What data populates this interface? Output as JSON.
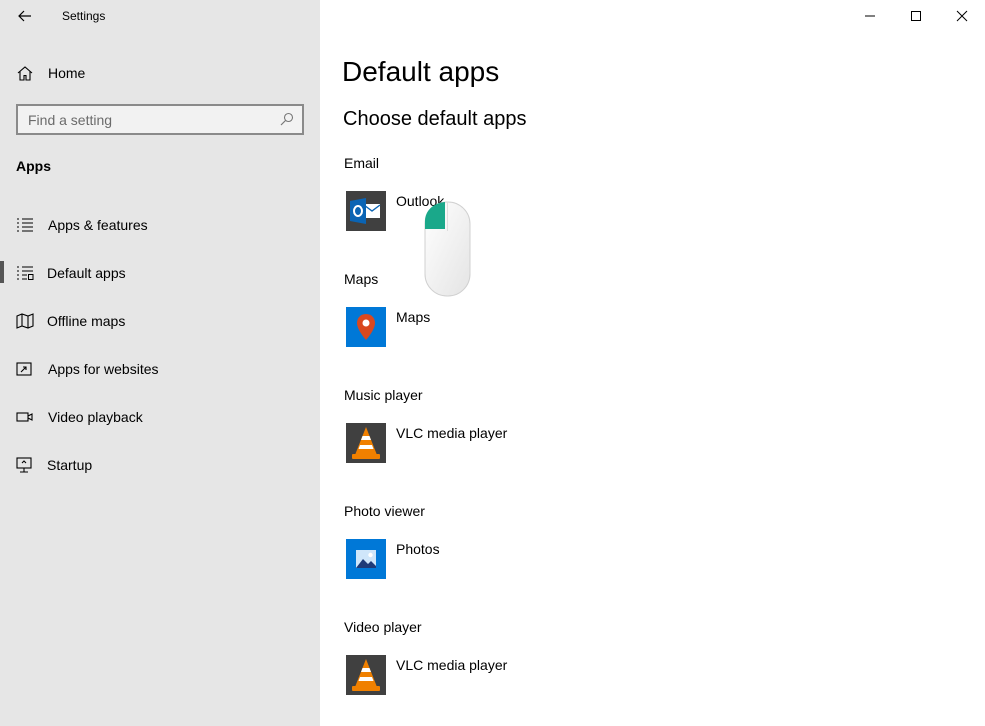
{
  "window": {
    "title": "Settings",
    "controls": {
      "minimize_icon": "minimize-icon",
      "maximize_icon": "maximize-icon",
      "close_icon": "close-icon"
    }
  },
  "sidebar": {
    "home_label": "Home",
    "search_placeholder": "Find a setting",
    "section_title": "Apps",
    "items": [
      {
        "label": "Apps & features",
        "icon": "list-icon",
        "selected": false
      },
      {
        "label": "Default apps",
        "icon": "default-apps-icon",
        "selected": true
      },
      {
        "label": "Offline maps",
        "icon": "map-icon",
        "selected": false
      },
      {
        "label": "Apps for websites",
        "icon": "link-window-icon",
        "selected": false
      },
      {
        "label": "Video playback",
        "icon": "video-icon",
        "selected": false
      },
      {
        "label": "Startup",
        "icon": "startup-icon",
        "selected": false
      }
    ]
  },
  "main": {
    "page_title": "Default apps",
    "subtitle": "Choose default apps",
    "categories": [
      {
        "label": "Email",
        "app": "Outlook",
        "icon": "outlook-icon",
        "tile_color": "#404040"
      },
      {
        "label": "Maps",
        "app": "Maps",
        "icon": "maps-icon",
        "tile_color": "#0078d7"
      },
      {
        "label": "Music player",
        "app": "VLC media player",
        "icon": "vlc-icon",
        "tile_color": "#404040"
      },
      {
        "label": "Photo viewer",
        "app": "Photos",
        "icon": "photos-icon",
        "tile_color": "#0078d7"
      },
      {
        "label": "Video player",
        "app": "VLC media player",
        "icon": "vlc-icon",
        "tile_color": "#404040"
      }
    ]
  },
  "colors": {
    "sidebar_bg": "#e6e6e6",
    "accent_blue": "#0078d7",
    "cursor_accent": "#1aa88a"
  }
}
